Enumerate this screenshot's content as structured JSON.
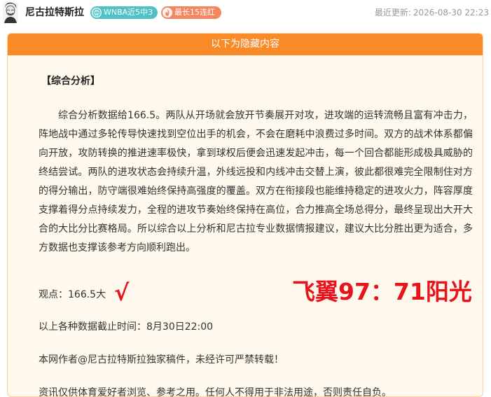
{
  "header": {
    "author": "尼古拉特斯拉",
    "badges": [
      {
        "icon": "basketball-icon",
        "label": "WNBA近5中3",
        "color": "#4fc1c7"
      },
      {
        "icon": "flame-icon",
        "label": "最长15连红",
        "color": "#f5855e"
      }
    ],
    "update_label": "最近更新:",
    "update_time": "2026-08-30 22:23"
  },
  "card": {
    "header_label": "以下为隐藏内容",
    "section_title": "【综合分析】",
    "paragraph": "综合分析数据给166.5。两队从开场就会放开节奏展开对攻，进攻端的运转流畅且富有冲击力，阵地战中通过多轮传导快速找到空位出手的机会，不会在磨耗中浪费过多时间。双方的战术体系都偏向开放，攻防转换的推进速率极快，拿到球权后便会迅速发起冲击，每一个回合都能形成极具威胁的终结尝试。两队的进攻状态会持续升温，外线远投和内线冲击交替上演，彼此都很难完全限制住对方的得分输出，防守端很难始终保持高强度的覆盖。双方在衔接段也能维持稳定的进攻火力，阵容厚度支撑着得分点持续发力，全程的进攻节奏始终保持在高位，合力推高全场总得分，最终呈现出大开大合的大比分比赛格局。所以综合以上分析和尼古拉专业数据情报建议，建议大比分胜出更为适合，多方数据也支撑该参考方向顺利跑出。",
    "opinion": "观点：166.5大",
    "check_mark": "√",
    "result": "飞翼97：71阳光",
    "cutoff": "以上各种数据截止时间：8月30日22:00",
    "copyright": "本网作者@尼古拉特斯拉独家稿件，未经许可严禁转载！",
    "disclaimer": "资讯仅供体育爱好者浏览、参考之用。任何人不得用于非法用途，否则责任自负。",
    "colors": {
      "accent_orange": "#f98a28",
      "card_background": "#fff8ec",
      "highlight_red": "#e8141b"
    }
  }
}
